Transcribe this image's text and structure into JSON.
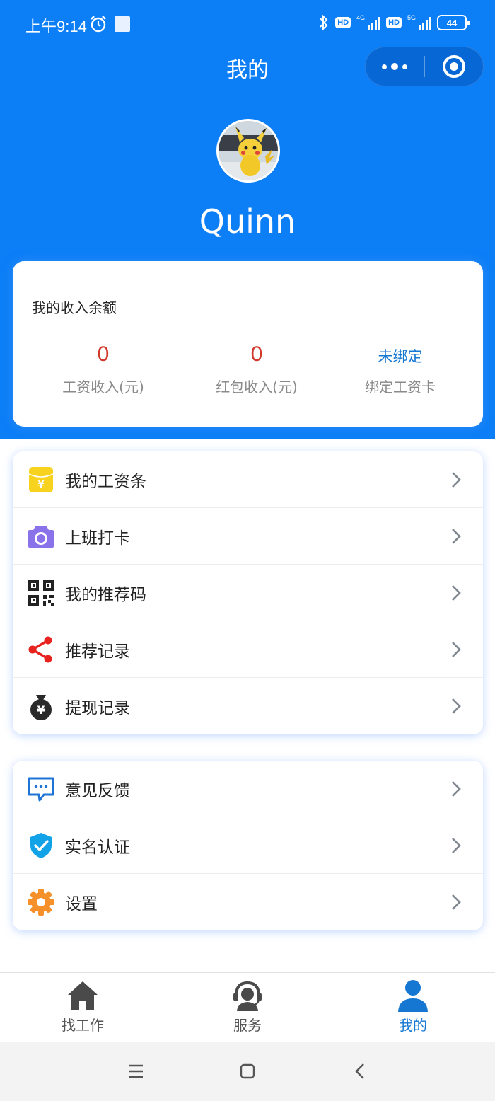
{
  "status_bar": {
    "time": "上午9:14",
    "network_4g": "4G",
    "network_5g": "5G",
    "hd_label": "HD",
    "battery": "44"
  },
  "nav": {
    "title": "我的"
  },
  "profile": {
    "name": "Quinn"
  },
  "income": {
    "title": "我的收入余额",
    "salary_value": "0",
    "salary_label": "工资收入(元)",
    "redpacket_value": "0",
    "redpacket_label": "红包收入(元)",
    "card_status": "未绑定",
    "card_label": "绑定工资卡"
  },
  "menu_group_1": [
    {
      "label": "我的工资条",
      "icon": "payslip-icon"
    },
    {
      "label": "上班打卡",
      "icon": "camera-icon"
    },
    {
      "label": "我的推荐码",
      "icon": "qr-code-icon"
    },
    {
      "label": "推荐记录",
      "icon": "share-icon"
    },
    {
      "label": "提现记录",
      "icon": "money-bag-icon"
    }
  ],
  "menu_group_2": [
    {
      "label": "意见反馈",
      "icon": "feedback-icon"
    },
    {
      "label": "实名认证",
      "icon": "shield-check-icon"
    },
    {
      "label": "设置",
      "icon": "gear-icon"
    }
  ],
  "tabbar": {
    "tab_jobs": "找工作",
    "tab_service": "服务",
    "tab_mine": "我的"
  },
  "colors": {
    "primary_blue": "#0c7ef6",
    "income_red": "#d1372a",
    "link_blue": "#1677d2"
  }
}
